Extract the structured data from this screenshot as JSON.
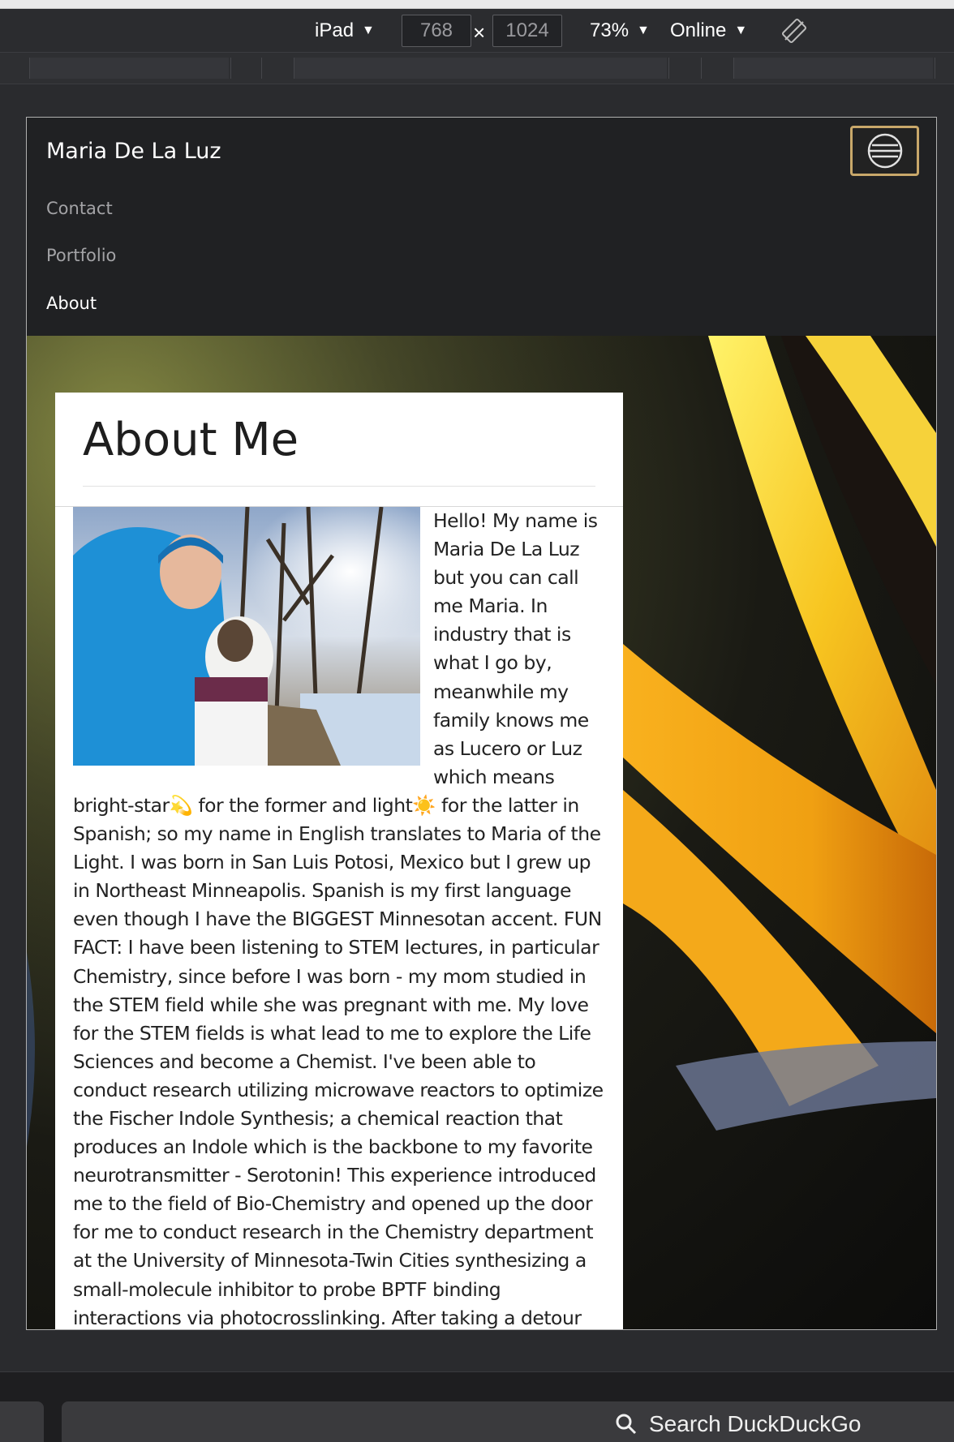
{
  "devtools": {
    "device": "iPad",
    "width": "768",
    "times": "×",
    "height": "1024",
    "zoom": "73%",
    "network": "Online"
  },
  "site": {
    "brand": "Maria De La Luz",
    "nav": [
      {
        "label": "Contact"
      },
      {
        "label": "Portfolio"
      },
      {
        "label": "About"
      }
    ],
    "accent": "#c9a86a"
  },
  "about": {
    "title": "About Me",
    "text": "Hello! My name is Maria De La Luz but you can call me Maria. In industry that is what I go by, meanwhile my family knows me as Lucero or Luz which means bright-star💫 for the former and light☀️ for the latter in Spanish; so my name in English translates to Maria of the Light. I was born in San Luis Potosi, Mexico but I grew up in Northeast Minneapolis. Spanish is my first language even though I have the BIGGEST Minnesotan accent. FUN FACT: I have been listening to STEM lectures, in particular Chemistry, since before I was born - my mom studied in the STEM field while she was pregnant with me. My love for the STEM fields is what lead to me to explore the Life Sciences and become a Chemist. I've been able to conduct research utilizing microwave reactors to optimize the Fischer Indole Synthesis; a chemical reaction that produces an Indole which is the backbone to my favorite neurotransmitter - Serotonin! This experience introduced me to the field of Bio-Chemistry and opened up the door for me to conduct research in the Chemistry department at the University of Minnesota-Twin Cities synthesizing a small-molecule inhibitor to probe BPTF binding interactions via photocrosslinking. After taking a detour post-graduation to work for the Minnesota"
  },
  "browser": {
    "search_label": "Search DuckDuckGo"
  }
}
